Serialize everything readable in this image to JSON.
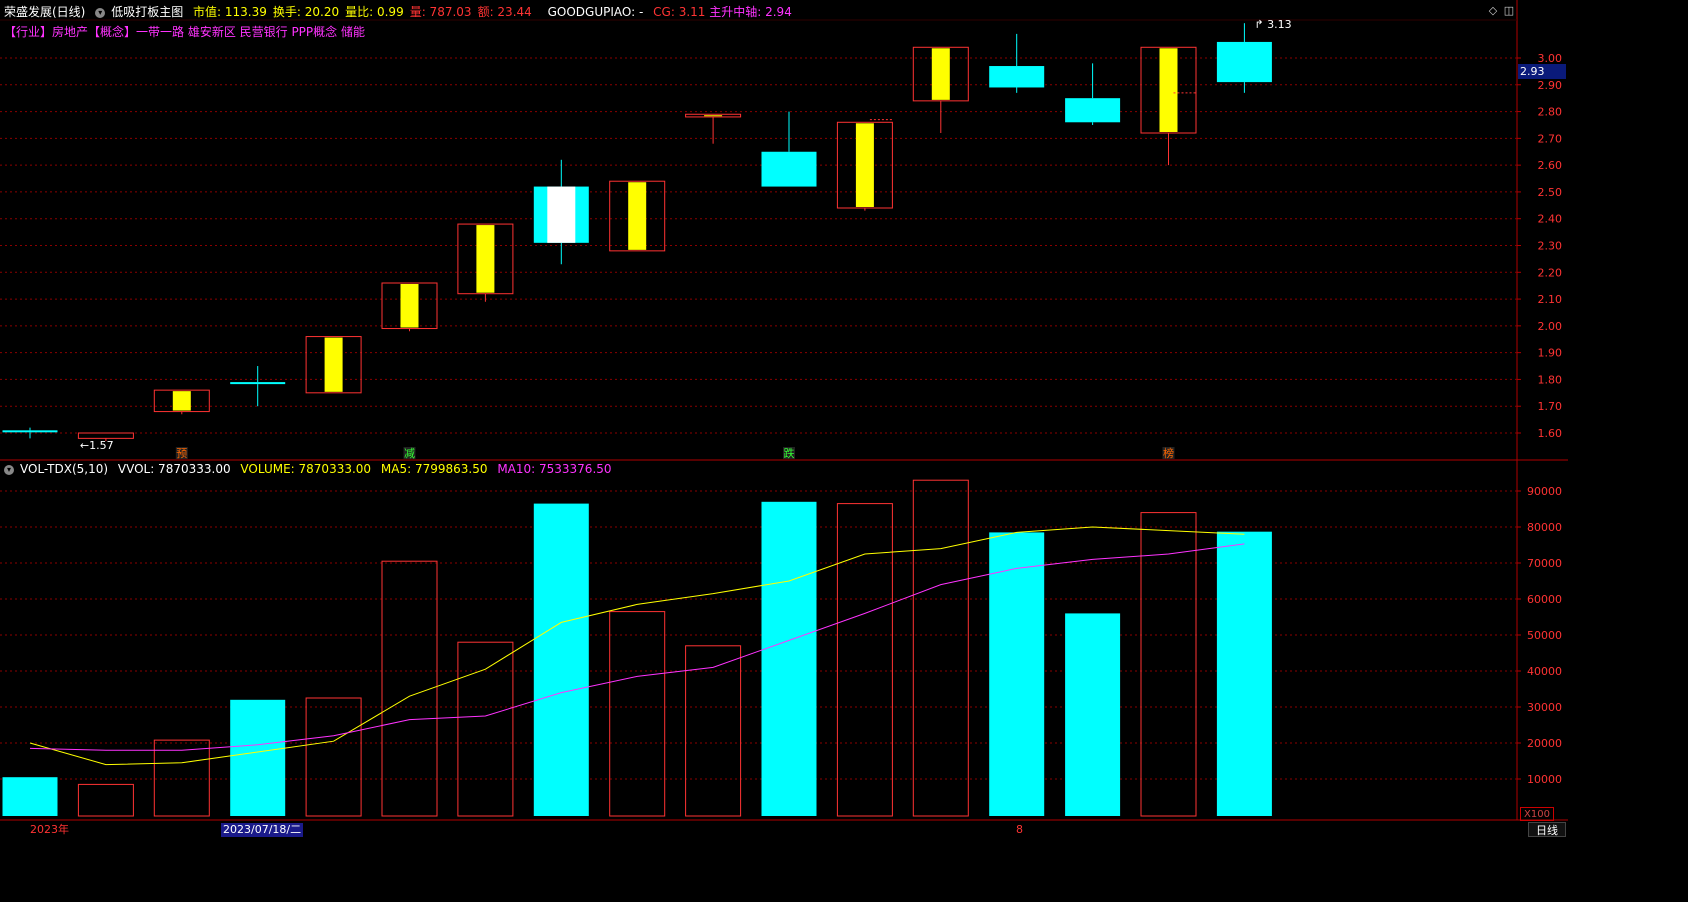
{
  "header": {
    "stock_name": "荣盛发展(日线)",
    "formula_name": "低吸打板主图",
    "items": [
      {
        "label": "市值:",
        "value": "113.39",
        "color": "#ffff00"
      },
      {
        "label": "换手:",
        "value": "20.20",
        "color": "#ffff00"
      },
      {
        "label": "量比:",
        "value": "0.99",
        "color": "#ffff00"
      },
      {
        "label": "量:",
        "value": "787.03",
        "color": "#ff3333"
      },
      {
        "label": "额:",
        "value": "23.44",
        "color": "#ff3333"
      }
    ],
    "goodgupiao": "GOODGUPIAO: -",
    "cg": "CG: 3.11",
    "trend_axis": "主升中轴: 2.94"
  },
  "tags": "【行业】房地产【概念】一带一路 雄安新区 民营银行 PPP概念 储能",
  "price_axis": {
    "ticks": [
      "3.00",
      "2.90",
      "2.80",
      "2.70",
      "2.60",
      "2.50",
      "2.40",
      "2.30",
      "2.20",
      "2.10",
      "2.00",
      "1.90",
      "1.80",
      "1.70",
      "1.60"
    ],
    "current_price": "2.93",
    "high_label": "3.13",
    "low_label": "1.57",
    "range": [
      1.58,
      3.09
    ]
  },
  "markers": [
    {
      "text": "预",
      "index": 2,
      "color": "#ff6600"
    },
    {
      "text": "减",
      "index": 5,
      "color": "#33ff33"
    },
    {
      "text": "跌",
      "index": 10,
      "color": "#33ff33"
    },
    {
      "text": "榜",
      "index": 15,
      "color": "#ff6600"
    }
  ],
  "volume_header": {
    "indicator": "VOL-TDX(5,10)",
    "vvol": "VVOL: 7870333.00",
    "volume": "VOLUME: 7870333.00",
    "ma5": "MA5: 7799863.50",
    "ma10": "MA10: 7533376.50"
  },
  "volume_axis": {
    "ticks": [
      "90000",
      "80000",
      "70000",
      "60000",
      "50000",
      "40000",
      "30000",
      "20000",
      "10000"
    ],
    "multiplier": "X100",
    "range": [
      0,
      100000
    ]
  },
  "date_axis": {
    "labels": [
      {
        "text": "2023年",
        "index": 0,
        "selected": false
      },
      {
        "text": "2023/07/18/二",
        "index": 3,
        "selected": true
      },
      {
        "text": "8",
        "index": 13,
        "selected": false
      }
    ]
  },
  "period_button": "日线",
  "colors": {
    "up": "#ff3333",
    "down": "#00ffff",
    "yellow": "#ffff00",
    "ma10": "#ff33ff",
    "grid": "#8b0000"
  },
  "chart_data": {
    "type": "candlestick",
    "candles": [
      {
        "o": 1.61,
        "h": 1.62,
        "l": 1.58,
        "c": 1.61,
        "style": "down"
      },
      {
        "o": 1.58,
        "h": 1.6,
        "l": 1.57,
        "c": 1.6,
        "style": "up"
      },
      {
        "o": 1.68,
        "h": 1.76,
        "l": 1.67,
        "c": 1.76,
        "style": "up-yellow"
      },
      {
        "o": 1.79,
        "h": 1.85,
        "l": 1.7,
        "c": 1.79,
        "style": "down"
      },
      {
        "o": 1.75,
        "h": 1.96,
        "l": 1.75,
        "c": 1.96,
        "style": "up-yellow"
      },
      {
        "o": 1.99,
        "h": 2.16,
        "l": 1.98,
        "c": 2.16,
        "style": "up-yellow"
      },
      {
        "o": 2.12,
        "h": 2.38,
        "l": 2.09,
        "c": 2.38,
        "style": "up-yellow"
      },
      {
        "o": 2.52,
        "h": 2.62,
        "l": 2.23,
        "c": 2.31,
        "style": "down-white"
      },
      {
        "o": 2.28,
        "h": 2.54,
        "l": 2.28,
        "c": 2.54,
        "style": "up-yellow"
      },
      {
        "o": 2.78,
        "h": 2.79,
        "l": 2.68,
        "c": 2.79,
        "style": "up-yellow"
      },
      {
        "o": 2.65,
        "h": 2.8,
        "l": 2.52,
        "c": 2.52,
        "style": "down"
      },
      {
        "o": 2.44,
        "h": 2.76,
        "l": 2.43,
        "c": 2.76,
        "style": "up-yellow"
      },
      {
        "o": 2.84,
        "h": 3.04,
        "l": 2.72,
        "c": 3.04,
        "style": "up-yellow"
      },
      {
        "o": 2.97,
        "h": 3.09,
        "l": 2.87,
        "c": 2.89,
        "style": "down"
      },
      {
        "o": 2.85,
        "h": 2.98,
        "l": 2.75,
        "c": 2.76,
        "style": "down"
      },
      {
        "o": 2.72,
        "h": 3.04,
        "l": 2.6,
        "c": 3.04,
        "style": "up-yellow"
      },
      {
        "o": 3.06,
        "h": 3.13,
        "l": 2.87,
        "c": 2.91,
        "style": "down"
      }
    ],
    "volume": [
      {
        "v": 10500,
        "style": "down"
      },
      {
        "v": 8500,
        "style": "up"
      },
      {
        "v": 20800,
        "style": "up"
      },
      {
        "v": 32000,
        "style": "down"
      },
      {
        "v": 32500,
        "style": "up"
      },
      {
        "v": 70500,
        "style": "up"
      },
      {
        "v": 48000,
        "style": "up"
      },
      {
        "v": 86500,
        "style": "down"
      },
      {
        "v": 56500,
        "style": "up"
      },
      {
        "v": 47000,
        "style": "up"
      },
      {
        "v": 87000,
        "style": "down"
      },
      {
        "v": 86500,
        "style": "up"
      },
      {
        "v": 93000,
        "style": "up"
      },
      {
        "v": 78500,
        "style": "down"
      },
      {
        "v": 56000,
        "style": "down"
      },
      {
        "v": 84000,
        "style": "up"
      },
      {
        "v": 78700,
        "style": "down"
      }
    ],
    "ma5": [
      20000,
      14000,
      14500,
      17500,
      20500,
      33000,
      40500,
      53500,
      58500,
      61500,
      65000,
      72500,
      74000,
      78500,
      80000,
      79000,
      78000
    ],
    "ma10": [
      18500,
      18000,
      18000,
      19500,
      22000,
      26500,
      27500,
      34000,
      38500,
      41000,
      48500,
      56000,
      64000,
      68500,
      71000,
      72500,
      75300
    ]
  }
}
